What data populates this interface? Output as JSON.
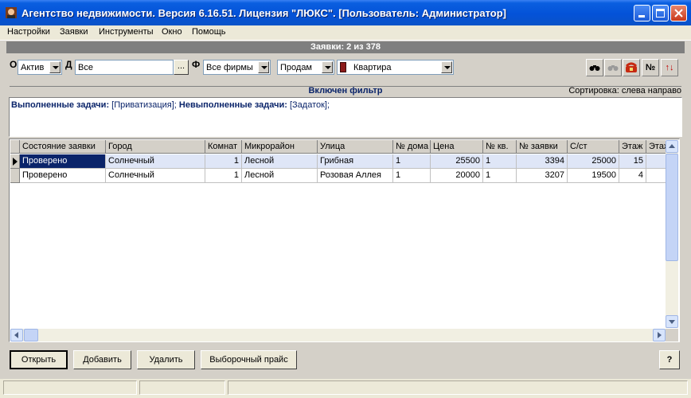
{
  "window": {
    "title": "Агентство недвижимости. Версия 6.16.51. Лицензия \"ЛЮКС\". [Пользователь: Администратор]"
  },
  "menu": [
    "Настройки",
    "Заявки",
    "Инструменты",
    "Окно",
    "Помощь"
  ],
  "header": {
    "count_text": "Заявки: 2 из 378"
  },
  "filters": {
    "label_o": "О",
    "status_value": "Актив",
    "label_d": "Д",
    "d_value": "Все",
    "browse_label": "...",
    "label_f": "Ф",
    "firm_value": "Все фирмы",
    "deal_value": "Продам",
    "object_value": "Квартира"
  },
  "toolbar": {
    "number_label": "№",
    "sort_label": "↑↓"
  },
  "filter_status": {
    "text": "Включен фильтр",
    "sort_text": "Сортировка: слева направо"
  },
  "tasks": {
    "done_label": "Выполненные задачи:",
    "done_value": " [Приватизация];",
    "undone_label": " Невыполненные задачи:",
    "undone_value": " [Задаток];"
  },
  "grid": {
    "columns": [
      "Состояние заявки",
      "Город",
      "Комнат",
      "Микрорайон",
      "Улица",
      "№ дома",
      "Цена",
      "№ кв.",
      "№ заявки",
      "С/ст",
      "Этаж",
      "Этаж"
    ],
    "rows": [
      [
        "Проверено",
        "Солнечный",
        "1",
        "Лесной",
        "Грибная",
        "1",
        "25500",
        "1",
        "3394",
        "25000",
        "15",
        ""
      ],
      [
        "Проверено",
        "Солнечный",
        "1",
        "Лесной",
        "Розовая Аллея",
        "1",
        "20000",
        "1",
        "3207",
        "19500",
        "4",
        ""
      ]
    ]
  },
  "buttons": {
    "open": "Открыть",
    "add": "Добавить",
    "delete": "Удалить",
    "price": "Выборочный прайс",
    "help": "?"
  }
}
